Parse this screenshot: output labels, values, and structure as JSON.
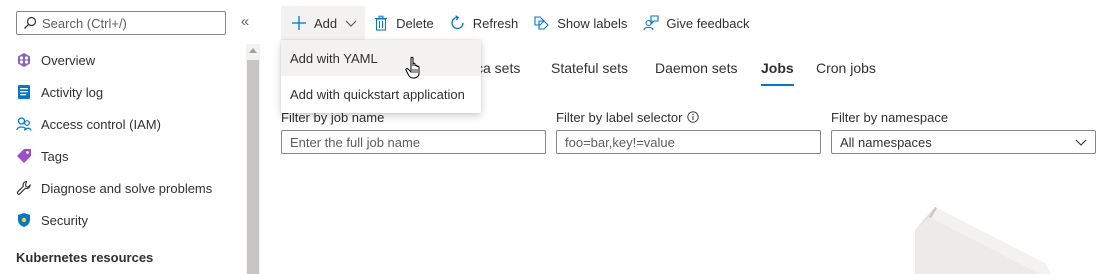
{
  "sidebar": {
    "search_placeholder": "Search (Ctrl+/)",
    "collapse_glyph": "«",
    "items": [
      {
        "label": "Overview",
        "icon": "overview-icon"
      },
      {
        "label": "Activity log",
        "icon": "activity-log-icon"
      },
      {
        "label": "Access control (IAM)",
        "icon": "iam-icon"
      },
      {
        "label": "Tags",
        "icon": "tag-icon"
      },
      {
        "label": "Diagnose and solve problems",
        "icon": "wrench-icon"
      },
      {
        "label": "Security",
        "icon": "shield-icon"
      }
    ],
    "section_header": "Kubernetes resources"
  },
  "toolbar": {
    "add_label": "Add",
    "delete_label": "Delete",
    "refresh_label": "Refresh",
    "show_labels_label": "Show labels",
    "feedback_label": "Give feedback"
  },
  "add_menu": {
    "items": [
      {
        "label": "Add with YAML"
      },
      {
        "label": "Add with quickstart application"
      }
    ]
  },
  "tabs": [
    {
      "label": "ca sets",
      "active": false
    },
    {
      "label": "Stateful sets",
      "active": false
    },
    {
      "label": "Daemon sets",
      "active": false
    },
    {
      "label": "Jobs",
      "active": true
    },
    {
      "label": "Cron jobs",
      "active": false
    }
  ],
  "filters": {
    "job_name": {
      "label": "Filter by job name",
      "placeholder": "Enter the full job name"
    },
    "label_selector": {
      "label": "Filter by label selector",
      "placeholder": "foo=bar,key!=value"
    },
    "namespace": {
      "label": "Filter by namespace",
      "value": "All namespaces"
    }
  },
  "colors": {
    "accent": "#0078d4",
    "overview_icon": "#8661c5",
    "tag_icon": "#9b4dca",
    "shield_icon": "#0078d4"
  }
}
